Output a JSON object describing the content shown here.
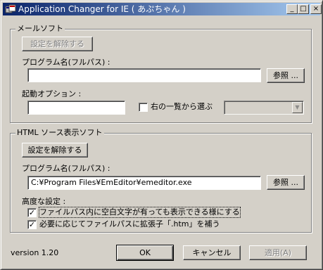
{
  "window": {
    "title": "Application Changer for IE ( あぷちゃん )"
  },
  "titlebar_buttons": {
    "minimize": "_",
    "maximize": "□",
    "close": "×"
  },
  "mail_group": {
    "label": "メールソフト",
    "unset_button": "設定を解除する",
    "program_label": "プログラム名(フルパス) :",
    "program_value": "",
    "browse_button": "参照 ...",
    "options_label": "起動オプション :",
    "options_value": "",
    "choose_label": "右の一覧から選ぶ",
    "choose_checked": false,
    "list_selected": ""
  },
  "html_group": {
    "label": "HTML ソース表示ソフト",
    "unset_button": "設定を解除する",
    "program_label": "プログラム名(フルパス) :",
    "program_value": "C:¥Program Files¥EmEditor¥emeditor.exe",
    "browse_button": "参照 ...",
    "advanced_label": "高度な設定 :",
    "opt1_label": "ファイルパス内に空白文字が有っても表示できる様にする",
    "opt1_checked": true,
    "opt2_label": "必要に応じてファイルパスに拡張子「.htm」を補う",
    "opt2_checked": true
  },
  "footer": {
    "version": "version 1.20",
    "ok": "OK",
    "cancel": "キャンセル",
    "apply": "適用(A)"
  },
  "colors": {
    "face": "#d4d0c8",
    "title_start": "#0a246a",
    "title_end": "#a6caf0",
    "disabled_text": "#808080"
  }
}
